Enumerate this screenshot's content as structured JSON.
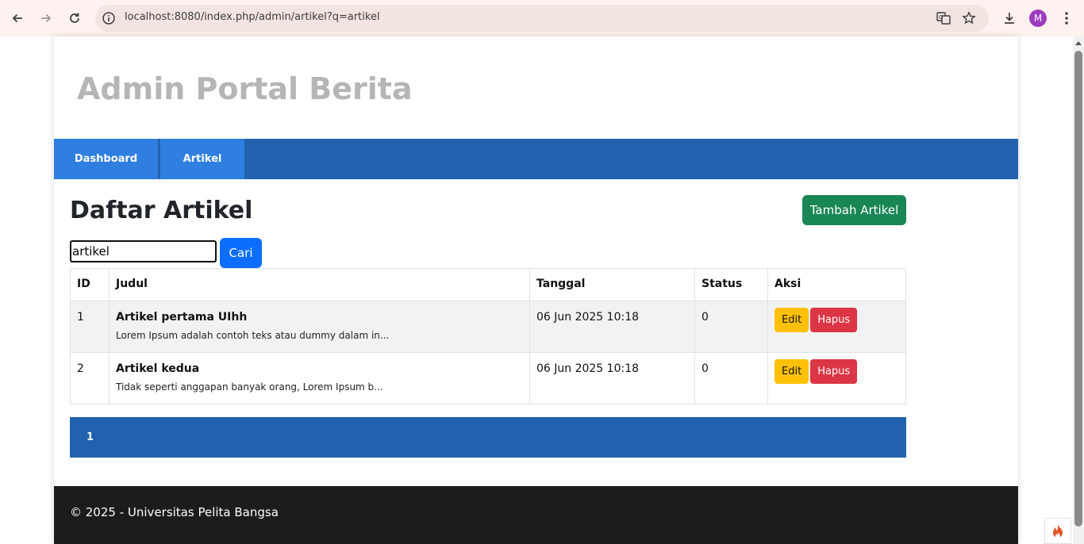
{
  "browser": {
    "url": "localhost:8080/index.php/admin/artikel?q=artikel",
    "profile_initial": "M",
    "icons": [
      "back-icon",
      "forward-icon",
      "reload-icon",
      "site-info-icon",
      "translate-icon",
      "bookmark-star-icon",
      "download-icon",
      "profile-avatar",
      "menu-kebab-icon"
    ]
  },
  "site": {
    "title": "Admin Portal Berita"
  },
  "nav": {
    "items": [
      {
        "label": "Dashboard"
      },
      {
        "label": "Artikel"
      }
    ]
  },
  "main": {
    "heading": "Daftar Artikel",
    "add_button": "Tambah Artikel",
    "search": {
      "value": "artikel",
      "button": "Cari"
    },
    "table": {
      "headers": [
        "ID",
        "Judul",
        "Tanggal",
        "Status",
        "Aksi"
      ],
      "rows": [
        {
          "id": "1",
          "judul": "Artikel pertama UIhh",
          "excerpt": "Lorem Ipsum adalah contoh teks atau dummy dalam in...",
          "tanggal": "06 Jun 2025 10:18",
          "status": "0",
          "edit": "Edit",
          "hapus": "Hapus"
        },
        {
          "id": "2",
          "judul": "Artikel kedua",
          "excerpt": "Tidak seperti anggapan banyak orang, Lorem Ipsum b...",
          "tanggal": "06 Jun 2025 10:18",
          "status": "0",
          "edit": "Edit",
          "hapus": "Hapus"
        }
      ]
    },
    "pagination": {
      "current": "1"
    }
  },
  "footer": {
    "text": "© 2025 - Universitas Pelita Bangsa"
  },
  "colors": {
    "navbar": "#2062ad",
    "nav_active": "#2f7fe0",
    "add_button": "#198754",
    "search_button": "#0d6efd",
    "edit_button": "#ffc107",
    "hapus_button": "#dc3545",
    "footer": "#1c1c1c"
  }
}
